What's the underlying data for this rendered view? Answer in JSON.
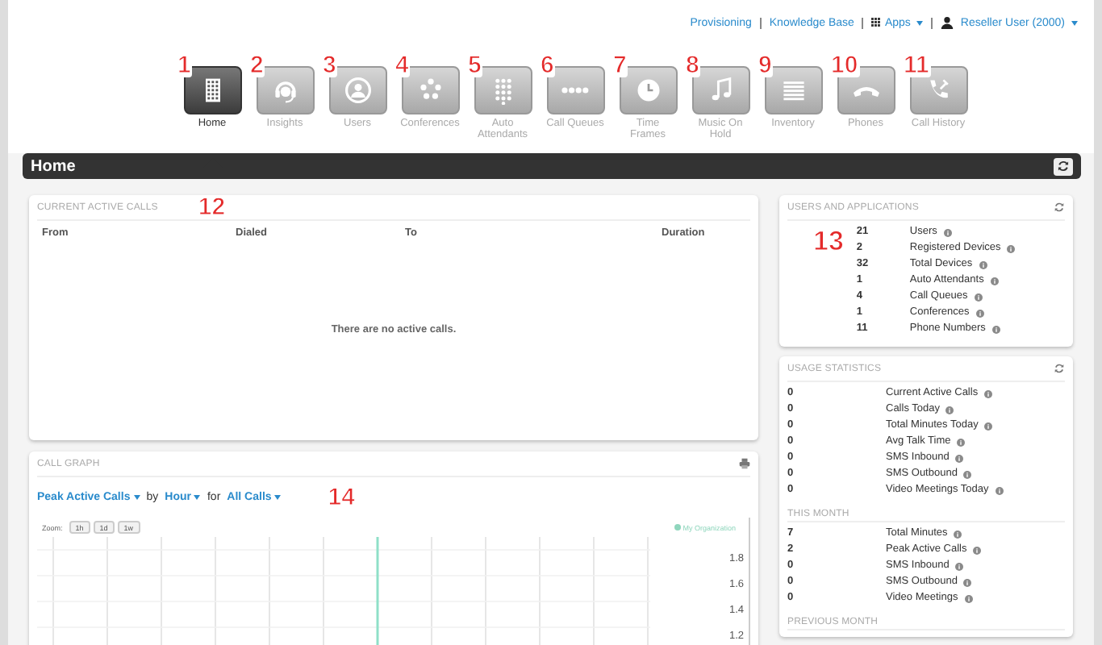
{
  "top_links": {
    "provisioning": "Provisioning",
    "knowledge_base": "Knowledge Base",
    "apps": "Apps",
    "user": "Reseller User (2000)"
  },
  "nav": [
    {
      "label": "Home",
      "kind": "building",
      "selected": true,
      "callout": "1"
    },
    {
      "label": "Insights",
      "kind": "headset",
      "selected": false,
      "callout": "2"
    },
    {
      "label": "Users",
      "kind": "users",
      "selected": false,
      "callout": "3"
    },
    {
      "label": "Conferences",
      "kind": "conference",
      "selected": false,
      "callout": "4"
    },
    {
      "label": "Auto Attendants",
      "kind": "keypad",
      "selected": false,
      "callout": "5"
    },
    {
      "label": "Call Queues",
      "kind": "dots",
      "selected": false,
      "callout": "6"
    },
    {
      "label": "Time Frames",
      "kind": "clock",
      "selected": false,
      "callout": "7"
    },
    {
      "label": "Music On Hold",
      "kind": "note",
      "selected": false,
      "callout": "8"
    },
    {
      "label": "Inventory",
      "kind": "list",
      "selected": false,
      "callout": "9"
    },
    {
      "label": "Phones",
      "kind": "phone",
      "selected": false,
      "callout": "10"
    },
    {
      "label": "Call History",
      "kind": "history",
      "selected": false,
      "callout": "11"
    }
  ],
  "page_title": "Home",
  "active_calls": {
    "title": "CURRENT ACTIVE CALLS",
    "callout": "12",
    "columns": [
      "From",
      "Dialed",
      "To",
      "Duration"
    ],
    "empty_message": "There are no active calls."
  },
  "call_graph": {
    "title": "CALL GRAPH",
    "callout": "14",
    "metric": "Peak Active Calls",
    "by_label": "by",
    "period": "Hour",
    "for_label": "for",
    "filter": "All Calls",
    "zoom_label": "Zoom:",
    "zoom_buttons": [
      "1h",
      "1d",
      "1w"
    ],
    "legend": "My Organization",
    "y_labels": [
      "1.8",
      "1.6",
      "1.4",
      "1.2"
    ]
  },
  "users_and_applications": {
    "title": "USERS AND APPLICATIONS",
    "callout": "13",
    "items": [
      {
        "value": "21",
        "label": "Users"
      },
      {
        "value": "2",
        "label": "Registered Devices"
      },
      {
        "value": "32",
        "label": "Total Devices"
      },
      {
        "value": "1",
        "label": "Auto Attendants"
      },
      {
        "value": "4",
        "label": "Call Queues"
      },
      {
        "value": "1",
        "label": "Conferences"
      },
      {
        "value": "11",
        "label": "Phone Numbers"
      }
    ]
  },
  "usage_statistics": {
    "title": "USAGE STATISTICS",
    "items": [
      {
        "value": "0",
        "label": "Current Active Calls"
      },
      {
        "value": "0",
        "label": "Calls Today"
      },
      {
        "value": "0",
        "label": "Total Minutes Today"
      },
      {
        "value": "0",
        "label": "Avg Talk Time"
      },
      {
        "value": "0",
        "label": "SMS Inbound"
      },
      {
        "value": "0",
        "label": "SMS Outbound"
      },
      {
        "value": "0",
        "label": "Video Meetings Today"
      }
    ],
    "sections": [
      {
        "title": "THIS MONTH",
        "items": [
          {
            "value": "7",
            "label": "Total Minutes"
          },
          {
            "value": "2",
            "label": "Peak Active Calls"
          },
          {
            "value": "0",
            "label": "SMS Inbound"
          },
          {
            "value": "0",
            "label": "SMS Outbound"
          },
          {
            "value": "0",
            "label": "Video Meetings"
          }
        ]
      },
      {
        "title": "PREVIOUS MONTH"
      }
    ]
  }
}
